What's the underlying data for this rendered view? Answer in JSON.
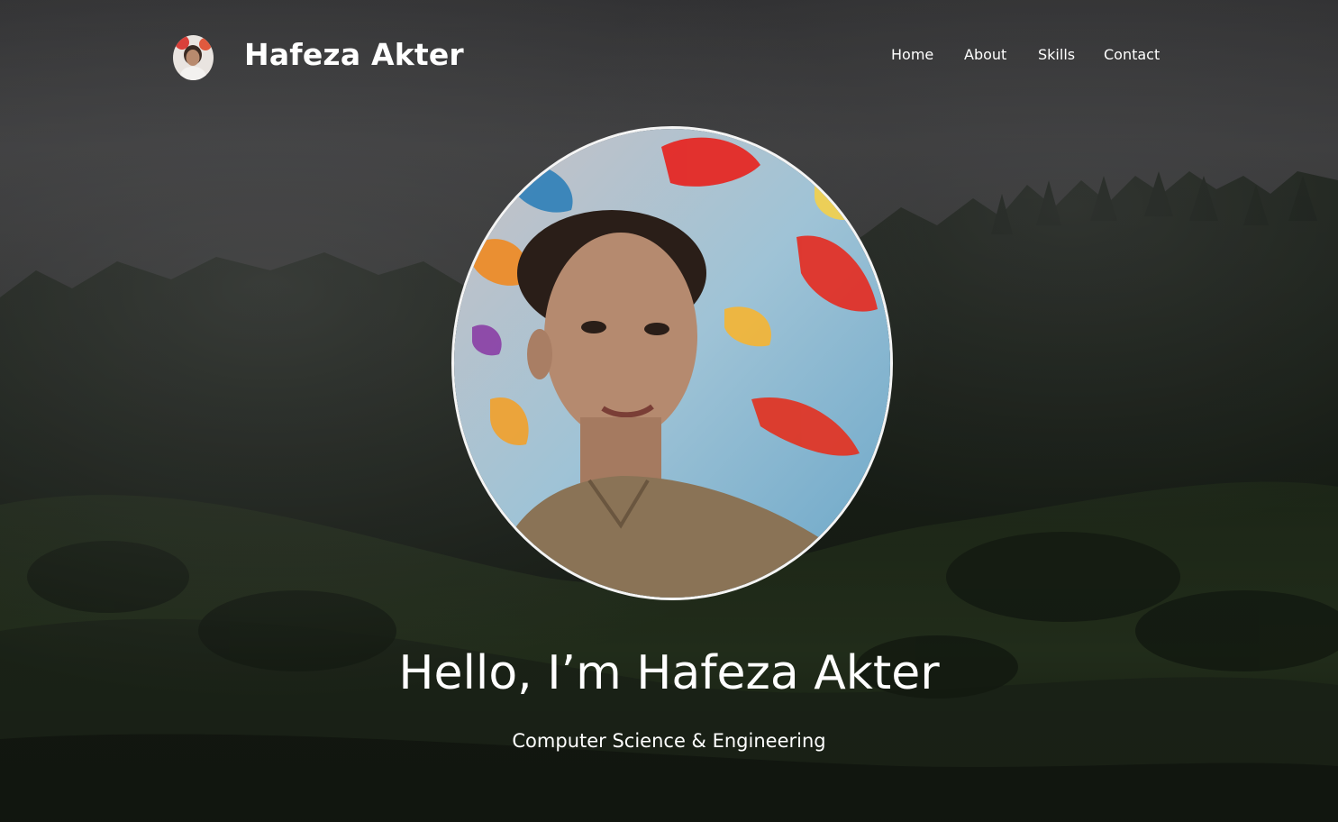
{
  "brand": {
    "name": "Hafeza Akter",
    "avatar_icon": "profile-avatar"
  },
  "nav": {
    "items": [
      {
        "label": "Home"
      },
      {
        "label": "About"
      },
      {
        "label": "Skills"
      },
      {
        "label": "Contact"
      }
    ]
  },
  "hero": {
    "title": "Hello, I’m Hafeza Akter",
    "subtitle": "Computer Science & Engineering",
    "photo_icon": "profile-photo"
  },
  "colors": {
    "text": "#ffffff",
    "photo_border": "#f4f4f4",
    "sky": "#3a3a3c",
    "forest": "#1f2a1e"
  }
}
